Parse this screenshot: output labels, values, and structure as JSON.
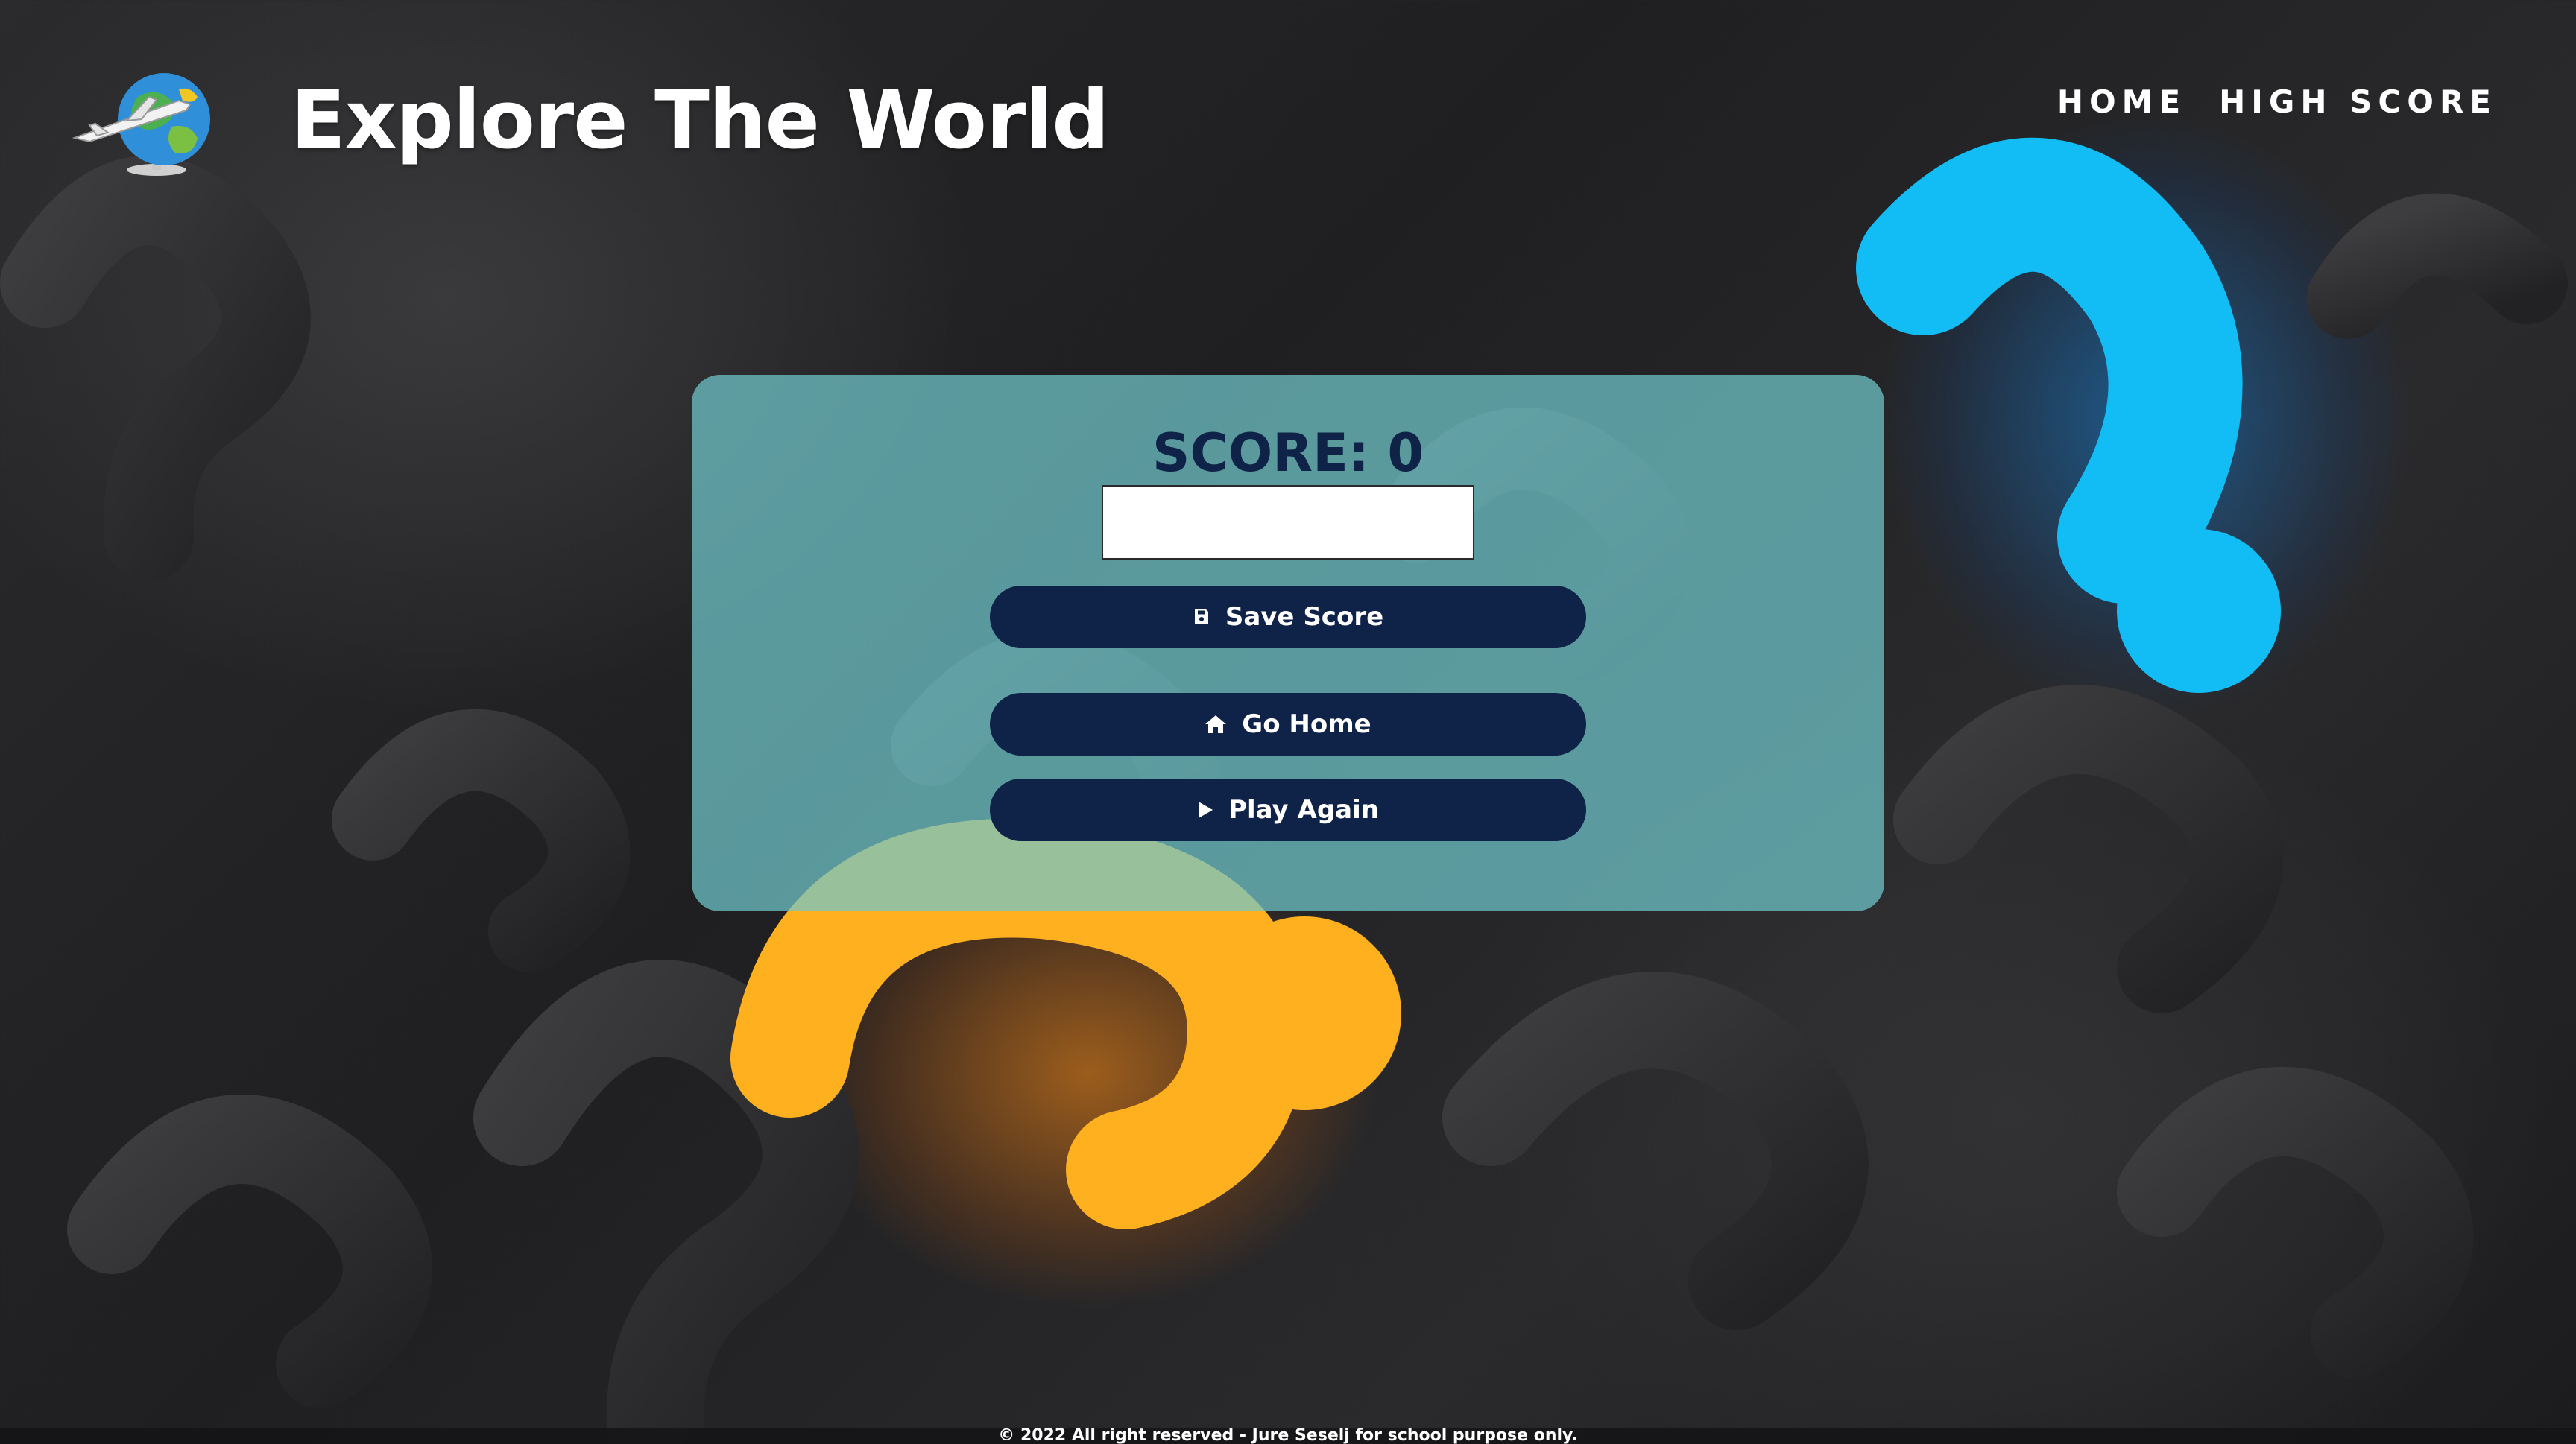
{
  "header": {
    "title": "Explore The World",
    "logo_icon": "globe-airplane-logo",
    "nav": [
      {
        "label": "HOME"
      },
      {
        "label": "HIGH SCORE"
      }
    ]
  },
  "panel": {
    "score_label": "SCORE: 0",
    "name_input": {
      "value": "",
      "placeholder": ""
    },
    "buttons": [
      {
        "label": "Save Score",
        "icon": "floppy-disk-icon"
      },
      {
        "label": "Go Home",
        "icon": "home-icon"
      },
      {
        "label": "Play Again",
        "icon": "play-icon"
      }
    ]
  },
  "footer": {
    "text": "© 2022 All right reserved - Jure Seselj for school purpose only."
  },
  "colors": {
    "panel": "#70c8cc",
    "button": "#0f2248",
    "text_dark": "#0f2248",
    "accent_orange": "#ffb01e",
    "accent_blue": "#12bdf5"
  }
}
